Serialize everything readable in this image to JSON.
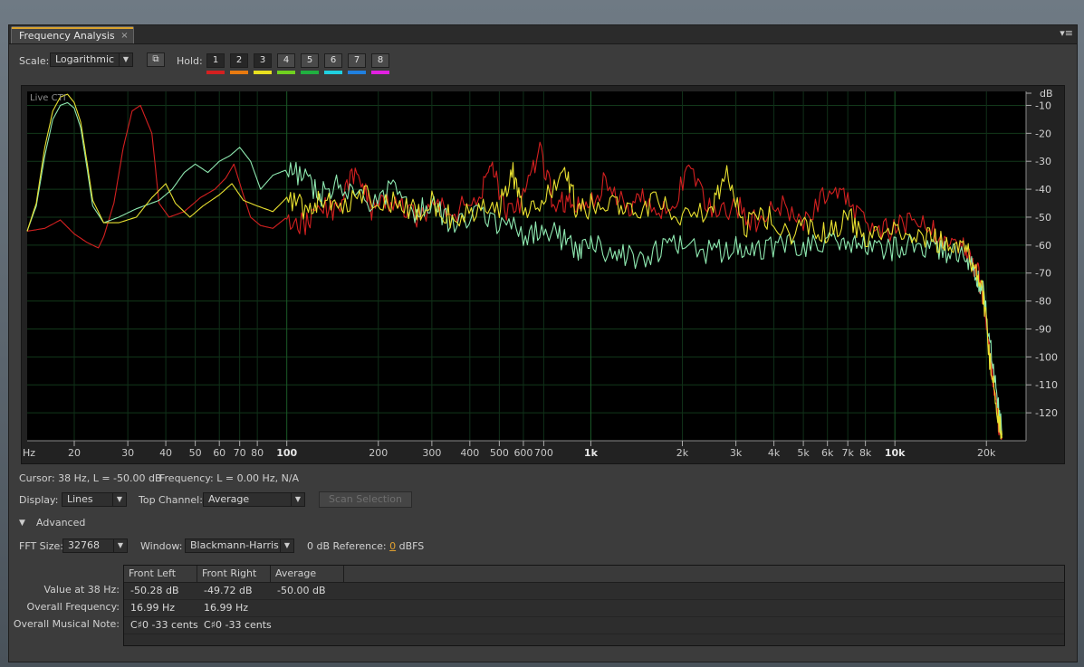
{
  "panel": {
    "tab_title": "Frequency Analysis",
    "close_glyph": "×",
    "menu_glyph": "▾≡"
  },
  "toolbar": {
    "scale_label": "Scale:",
    "scale_value": "Logarithmic",
    "hold_label": "Hold:",
    "hold_buttons": [
      {
        "label": "1",
        "color": "#d42020"
      },
      {
        "label": "2",
        "color": "#e87a10"
      },
      {
        "label": "3",
        "color": "#e8e020"
      },
      {
        "label": "4",
        "color": "#70d020"
      },
      {
        "label": "5",
        "color": "#20b040"
      },
      {
        "label": "6",
        "color": "#20d0e0"
      },
      {
        "label": "7",
        "color": "#2080e0"
      },
      {
        "label": "8",
        "color": "#e020e0"
      }
    ]
  },
  "graph": {
    "live_label": "Live CTI",
    "db_unit": "dB",
    "hz_unit": "Hz"
  },
  "chart_data": {
    "type": "line",
    "x_scale": "log",
    "xlim": [
      14,
      27000
    ],
    "ylim": [
      -130,
      -5
    ],
    "x_ticks": [
      {
        "value": 20,
        "label": "20"
      },
      {
        "value": 30,
        "label": "30"
      },
      {
        "value": 40,
        "label": "40"
      },
      {
        "value": 50,
        "label": "50"
      },
      {
        "value": 60,
        "label": "60"
      },
      {
        "value": 70,
        "label": "70"
      },
      {
        "value": 80,
        "label": "80"
      },
      {
        "value": 100,
        "label": "100",
        "major": true
      },
      {
        "value": 200,
        "label": "200"
      },
      {
        "value": 300,
        "label": "300"
      },
      {
        "value": 400,
        "label": "400"
      },
      {
        "value": 500,
        "label": "500"
      },
      {
        "value": 600,
        "label": "600"
      },
      {
        "value": 700,
        "label": "700"
      },
      {
        "value": 1000,
        "label": "1k",
        "major": true
      },
      {
        "value": 2000,
        "label": "2k"
      },
      {
        "value": 3000,
        "label": "3k"
      },
      {
        "value": 4000,
        "label": "4k"
      },
      {
        "value": 5000,
        "label": "5k"
      },
      {
        "value": 6000,
        "label": "6k"
      },
      {
        "value": 7000,
        "label": "7k"
      },
      {
        "value": 8000,
        "label": "8k"
      },
      {
        "value": 10000,
        "label": "10k",
        "major": true
      },
      {
        "value": 20000,
        "label": "20k"
      }
    ],
    "y_ticks": [
      {
        "value": -10,
        "label": "-10"
      },
      {
        "value": -20,
        "label": "-20"
      },
      {
        "value": -30,
        "label": "-30"
      },
      {
        "value": -40,
        "label": "-40"
      },
      {
        "value": -50,
        "label": "-50"
      },
      {
        "value": -60,
        "label": "-60"
      },
      {
        "value": -70,
        "label": "-70"
      },
      {
        "value": -80,
        "label": "-80"
      },
      {
        "value": -90,
        "label": "-90"
      },
      {
        "value": -100,
        "label": "-100"
      },
      {
        "value": -110,
        "label": "-110"
      },
      {
        "value": -120,
        "label": "-120"
      }
    ],
    "series": [
      {
        "color": "#d42020",
        "points": [
          [
            14,
            -55
          ],
          [
            16,
            -54
          ],
          [
            18,
            -51
          ],
          [
            20,
            -56
          ],
          [
            22,
            -59
          ],
          [
            24,
            -61
          ],
          [
            25,
            -57
          ],
          [
            27,
            -45
          ],
          [
            29,
            -25
          ],
          [
            31,
            -12
          ],
          [
            33,
            -10
          ],
          [
            36,
            -20
          ],
          [
            38,
            -45
          ],
          [
            41,
            -50
          ],
          [
            46,
            -48
          ],
          [
            52,
            -43
          ],
          [
            58,
            -40
          ],
          [
            63,
            -36
          ],
          [
            67,
            -31
          ],
          [
            71,
            -40
          ],
          [
            76,
            -50
          ],
          [
            82,
            -53
          ],
          [
            90,
            -54
          ],
          [
            100,
            -50
          ],
          [
            115,
            -53
          ],
          [
            130,
            -46
          ],
          [
            150,
            -48
          ],
          [
            170,
            -30
          ],
          [
            190,
            -48
          ],
          [
            220,
            -44
          ],
          [
            260,
            -50
          ],
          [
            300,
            -46
          ],
          [
            350,
            -48
          ],
          [
            420,
            -45
          ],
          [
            470,
            -29
          ],
          [
            520,
            -48
          ],
          [
            600,
            -44
          ],
          [
            680,
            -27
          ],
          [
            760,
            -46
          ],
          [
            850,
            -44
          ],
          [
            950,
            -48
          ],
          [
            1100,
            -38
          ],
          [
            1300,
            -47
          ],
          [
            1500,
            -42
          ],
          [
            1800,
            -49
          ],
          [
            2100,
            -34
          ],
          [
            2500,
            -48
          ],
          [
            3000,
            -46
          ],
          [
            3500,
            -52
          ],
          [
            4200,
            -46
          ],
          [
            5000,
            -53
          ],
          [
            6000,
            -40
          ],
          [
            7000,
            -44
          ],
          [
            8000,
            -52
          ],
          [
            9500,
            -55
          ],
          [
            11000,
            -52
          ],
          [
            13000,
            -54
          ],
          [
            15000,
            -58
          ],
          [
            17000,
            -62
          ],
          [
            18500,
            -68
          ],
          [
            19500,
            -78
          ],
          [
            20500,
            -98
          ],
          [
            21500,
            -118
          ],
          [
            22500,
            -129
          ]
        ]
      },
      {
        "color": "#8ee8b0",
        "points": [
          [
            14,
            -55
          ],
          [
            15,
            -46
          ],
          [
            16,
            -28
          ],
          [
            17,
            -15
          ],
          [
            18,
            -10
          ],
          [
            19,
            -9
          ],
          [
            20,
            -11
          ],
          [
            21,
            -18
          ],
          [
            22,
            -32
          ],
          [
            23,
            -46
          ],
          [
            25,
            -52
          ],
          [
            28,
            -50
          ],
          [
            32,
            -47
          ],
          [
            38,
            -44
          ],
          [
            42,
            -40
          ],
          [
            46,
            -34
          ],
          [
            50,
            -31
          ],
          [
            55,
            -34
          ],
          [
            60,
            -30
          ],
          [
            65,
            -28
          ],
          [
            70,
            -25
          ],
          [
            76,
            -30
          ],
          [
            82,
            -40
          ],
          [
            90,
            -35
          ],
          [
            100,
            -33
          ],
          [
            115,
            -36
          ],
          [
            130,
            -42
          ],
          [
            150,
            -38
          ],
          [
            180,
            -45
          ],
          [
            220,
            -40
          ],
          [
            260,
            -48
          ],
          [
            300,
            -46
          ],
          [
            350,
            -52
          ],
          [
            420,
            -48
          ],
          [
            500,
            -52
          ],
          [
            600,
            -56
          ],
          [
            700,
            -54
          ],
          [
            800,
            -58
          ],
          [
            900,
            -61
          ],
          [
            1000,
            -60
          ],
          [
            1200,
            -63
          ],
          [
            1400,
            -65
          ],
          [
            1700,
            -62
          ],
          [
            2000,
            -60
          ],
          [
            2500,
            -63
          ],
          [
            3000,
            -60
          ],
          [
            3500,
            -62
          ],
          [
            4200,
            -59
          ],
          [
            5000,
            -62
          ],
          [
            6000,
            -58
          ],
          [
            7000,
            -61
          ],
          [
            8000,
            -60
          ],
          [
            9500,
            -62
          ],
          [
            11000,
            -60
          ],
          [
            13000,
            -61
          ],
          [
            15000,
            -62
          ],
          [
            17000,
            -64
          ],
          [
            18500,
            -70
          ],
          [
            19500,
            -77
          ],
          [
            20500,
            -95
          ],
          [
            21500,
            -112
          ],
          [
            22500,
            -128
          ]
        ]
      },
      {
        "color": "#e8e030",
        "points": [
          [
            14,
            -55
          ],
          [
            15,
            -45
          ],
          [
            16,
            -25
          ],
          [
            17,
            -12
          ],
          [
            18,
            -7
          ],
          [
            19,
            -6
          ],
          [
            20,
            -9
          ],
          [
            21,
            -16
          ],
          [
            22,
            -30
          ],
          [
            23,
            -44
          ],
          [
            25,
            -52
          ],
          [
            28,
            -52
          ],
          [
            32,
            -50
          ],
          [
            36,
            -43
          ],
          [
            40,
            -38
          ],
          [
            43,
            -45
          ],
          [
            48,
            -50
          ],
          [
            53,
            -46
          ],
          [
            60,
            -42
          ],
          [
            66,
            -38
          ],
          [
            72,
            -44
          ],
          [
            80,
            -46
          ],
          [
            90,
            -48
          ],
          [
            100,
            -43
          ],
          [
            115,
            -47
          ],
          [
            130,
            -44
          ],
          [
            150,
            -46
          ],
          [
            180,
            -43
          ],
          [
            220,
            -45
          ],
          [
            260,
            -48
          ],
          [
            300,
            -45
          ],
          [
            350,
            -50
          ],
          [
            420,
            -48
          ],
          [
            500,
            -46
          ],
          [
            550,
            -33
          ],
          [
            600,
            -49
          ],
          [
            700,
            -45
          ],
          [
            820,
            -30
          ],
          [
            900,
            -48
          ],
          [
            1000,
            -46
          ],
          [
            1200,
            -44
          ],
          [
            1400,
            -47
          ],
          [
            1700,
            -44
          ],
          [
            2000,
            -49
          ],
          [
            2500,
            -47
          ],
          [
            2800,
            -35
          ],
          [
            3200,
            -53
          ],
          [
            3800,
            -50
          ],
          [
            4500,
            -56
          ],
          [
            5200,
            -52
          ],
          [
            6000,
            -56
          ],
          [
            7000,
            -50
          ],
          [
            8000,
            -57
          ],
          [
            9500,
            -55
          ],
          [
            11000,
            -57
          ],
          [
            13000,
            -58
          ],
          [
            15000,
            -59
          ],
          [
            17000,
            -62
          ],
          [
            18500,
            -68
          ],
          [
            19500,
            -77
          ],
          [
            20500,
            -100
          ],
          [
            21500,
            -118
          ],
          [
            22500,
            -129
          ]
        ]
      }
    ]
  },
  "info": {
    "cursor_text": "Cursor: 38 Hz, L = -50.00 dB",
    "frequency_text": "Frequency: L = 0.00 Hz, N/A",
    "display_label": "Display:",
    "display_value": "Lines",
    "top_channel_label": "Top Channel:",
    "top_channel_value": "Average",
    "scan_selection": "Scan Selection",
    "advanced_label": "Advanced",
    "fft_label": "FFT Size:",
    "fft_value": "32768",
    "window_label": "Window:",
    "window_value": "Blackmann-Harris",
    "ref_label": "0 dB Reference:",
    "ref_value": "0",
    "ref_unit": "dBFS"
  },
  "table": {
    "columns": [
      "Front Left",
      "Front Right",
      "Average"
    ],
    "rows": [
      {
        "label": "Value at 38 Hz:",
        "cells": [
          "-50.28 dB",
          "-49.72 dB",
          "-50.00 dB"
        ]
      },
      {
        "label": "Overall Frequency:",
        "cells": [
          "16.99 Hz",
          "16.99 Hz",
          ""
        ]
      },
      {
        "label": "Overall Musical Note:",
        "cells": [
          "C♯0 -33 cents",
          "C♯0 -33 cents",
          ""
        ]
      }
    ]
  }
}
